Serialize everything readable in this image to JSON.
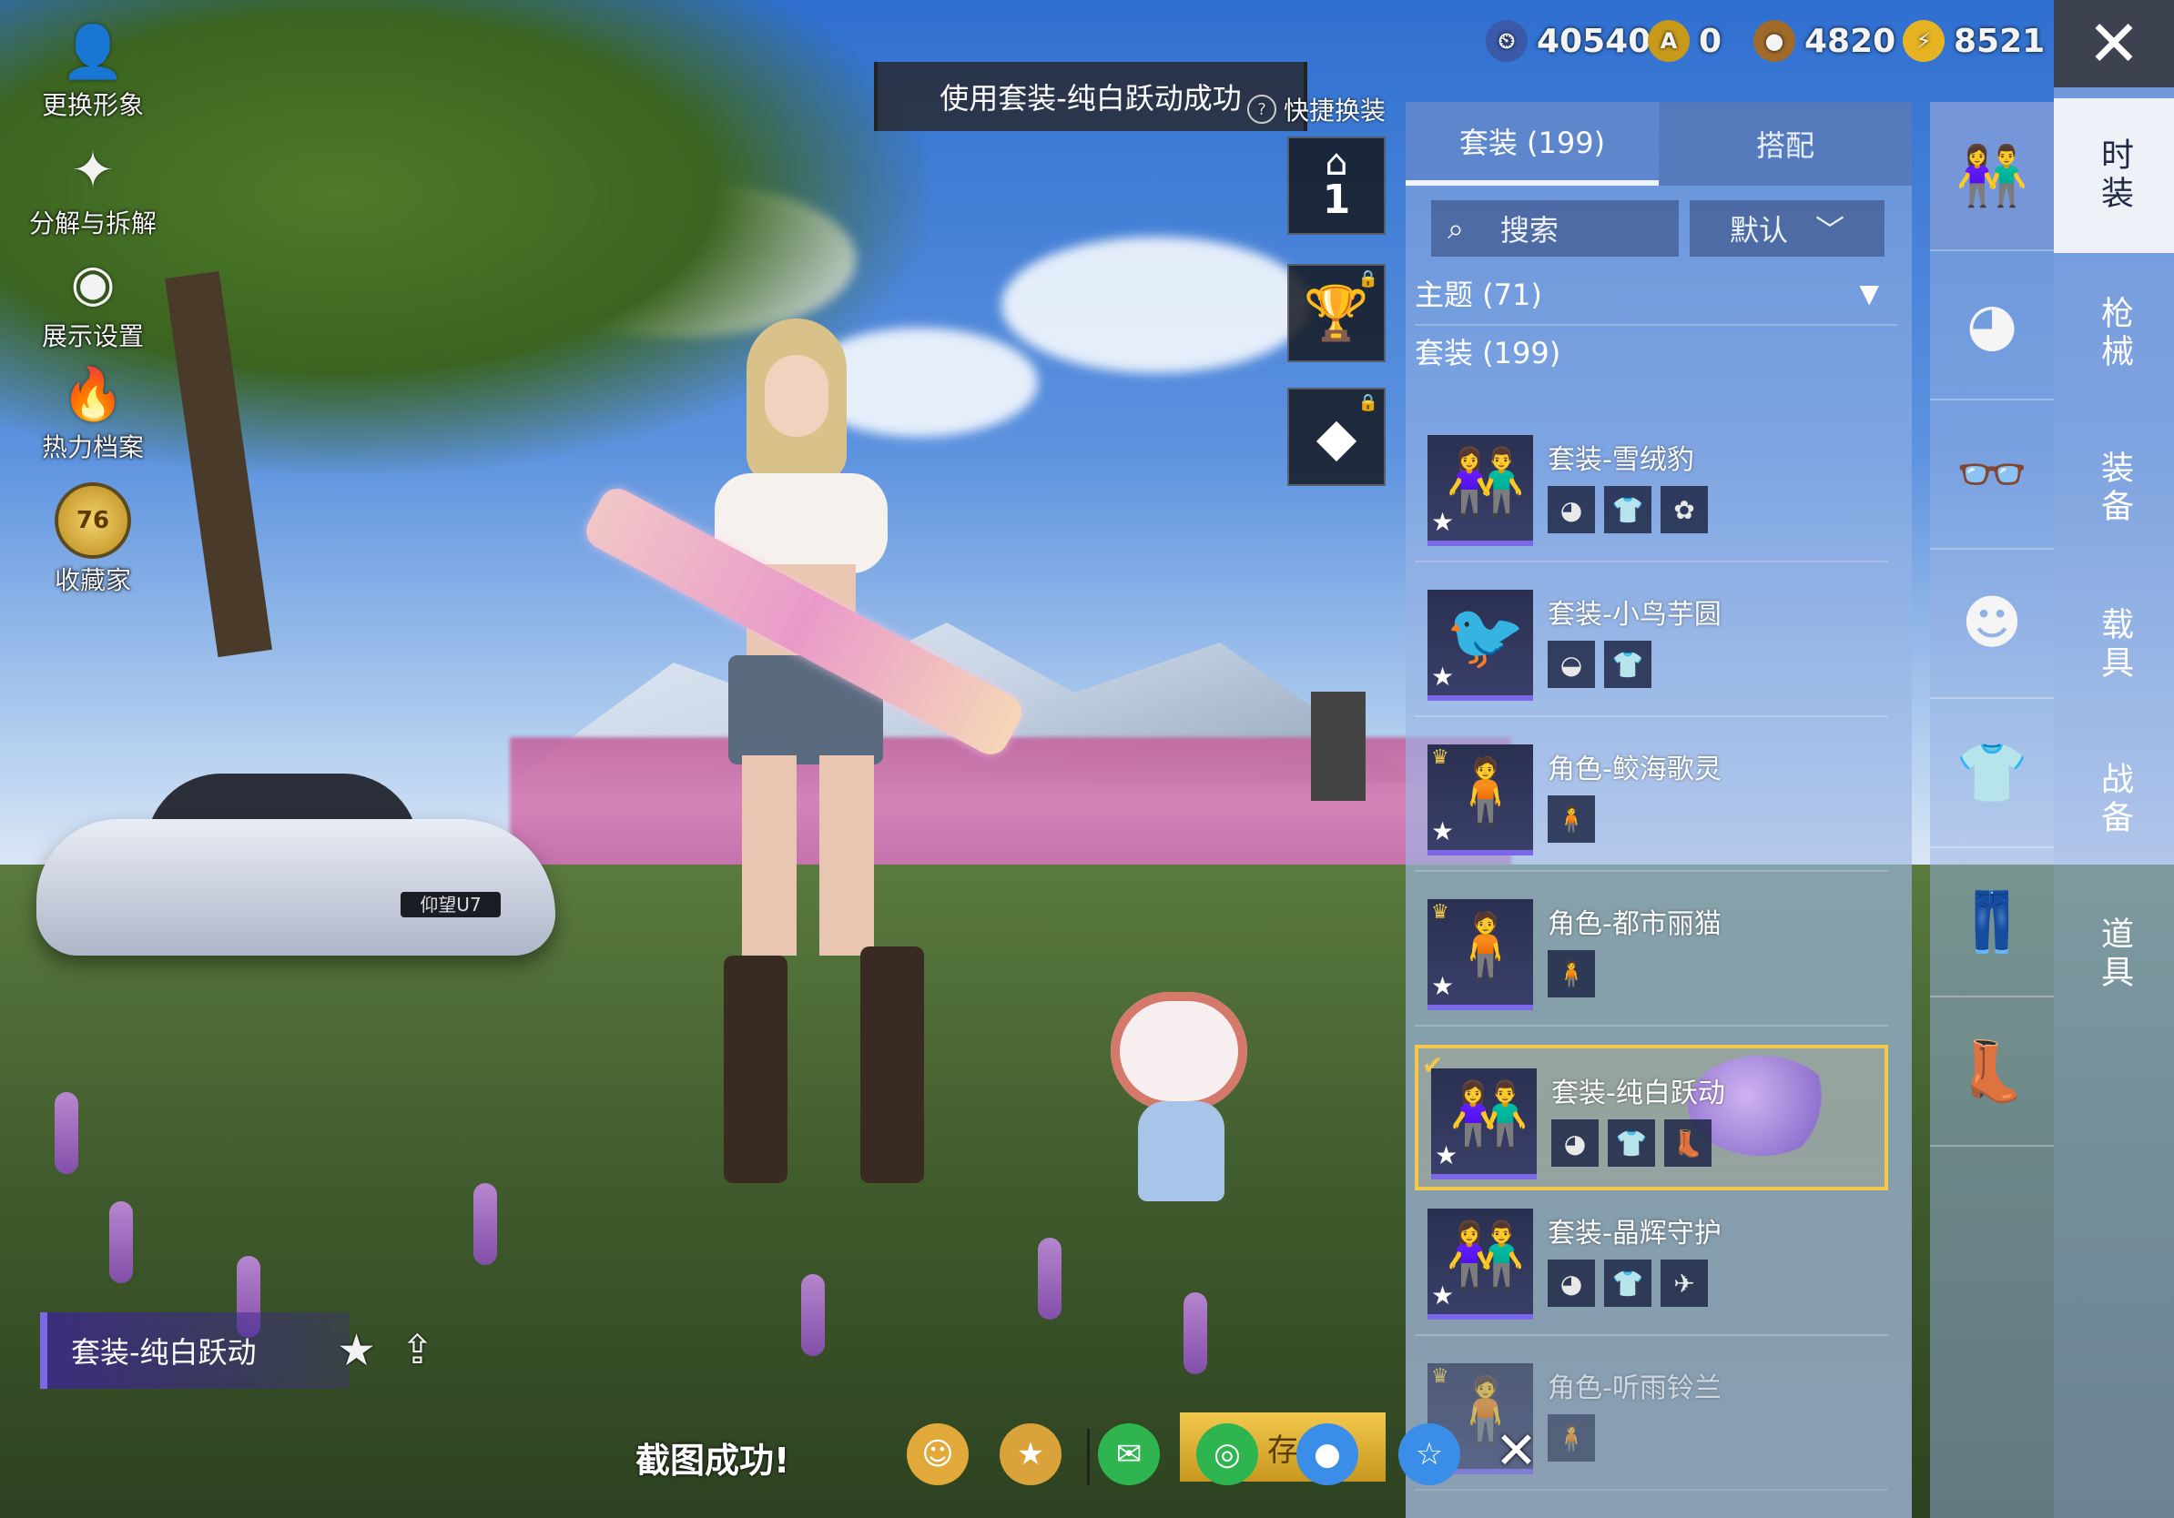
{
  "left_menu": [
    {
      "label": "更换形象",
      "icon": "avatar-icon"
    },
    {
      "label": "分解与拆解",
      "icon": "puzzle-icon"
    },
    {
      "label": "展示设置",
      "icon": "eye-icon"
    },
    {
      "label": "热力档案",
      "icon": "flame-icon"
    },
    {
      "label": "收藏家",
      "icon": "collector-badge-icon",
      "badge": "76"
    }
  ],
  "toast": "使用套装-纯白跃动成功",
  "quick_change": "快捷换装",
  "quick_slot": "1",
  "currency": [
    {
      "icon": "clock-coin-icon",
      "value": "40540",
      "color": "#3a5aa8"
    },
    {
      "icon": "gold-a-coin-icon",
      "value": "0",
      "color": "#c79a1a"
    },
    {
      "icon": "bronze-coin-icon",
      "value": "4820",
      "color": "#a06a2a"
    },
    {
      "icon": "lightning-coin-icon",
      "value": "8521",
      "color": "#e6b422"
    }
  ],
  "panel": {
    "tabs": [
      "套装 (199)",
      "搭配"
    ],
    "search_label": "搜索",
    "sort_label": "默认",
    "filter_theme": "主题 (71)",
    "filter_outfit": "套装 (199)",
    "items": [
      {
        "name": "套装-雪绒豹",
        "parts": [
          "hair",
          "top",
          "accessory"
        ],
        "crown": false,
        "selected": false
      },
      {
        "name": "套装-小鸟芋圆",
        "parts": [
          "hat",
          "outfit"
        ],
        "crown": false,
        "selected": false
      },
      {
        "name": "角色-鲛海歌灵",
        "parts": [
          "figure"
        ],
        "crown": true,
        "selected": false
      },
      {
        "name": "角色-都市丽猫",
        "parts": [
          "figure"
        ],
        "crown": true,
        "selected": false
      },
      {
        "name": "套装-纯白跃动",
        "parts": [
          "hair",
          "top",
          "boots"
        ],
        "crown": false,
        "selected": true
      },
      {
        "name": "套装-晶辉守护",
        "parts": [
          "hair",
          "outfit",
          "weapon"
        ],
        "crown": false,
        "selected": false
      },
      {
        "name": "角色-听雨铃兰",
        "parts": [
          "figure"
        ],
        "crown": true,
        "selected": false
      }
    ]
  },
  "categories": [
    "outfit-icon",
    "hair-icon",
    "glasses-icon",
    "face-mask-icon",
    "top-icon",
    "pants-icon",
    "boots-icon"
  ],
  "side_tabs": [
    "时装",
    "枪械",
    "装备",
    "载具",
    "战备",
    "道具"
  ],
  "bottom": {
    "outfit_name": "套装-纯白跃动",
    "screenshot_ok": "截图成功!",
    "save_label": "存",
    "share_targets": [
      "game-friends-icon",
      "peace-elite-icon",
      "wechat-icon",
      "moments-icon",
      "qq-icon",
      "qzone-icon"
    ],
    "car_plate": "仰望U7"
  }
}
